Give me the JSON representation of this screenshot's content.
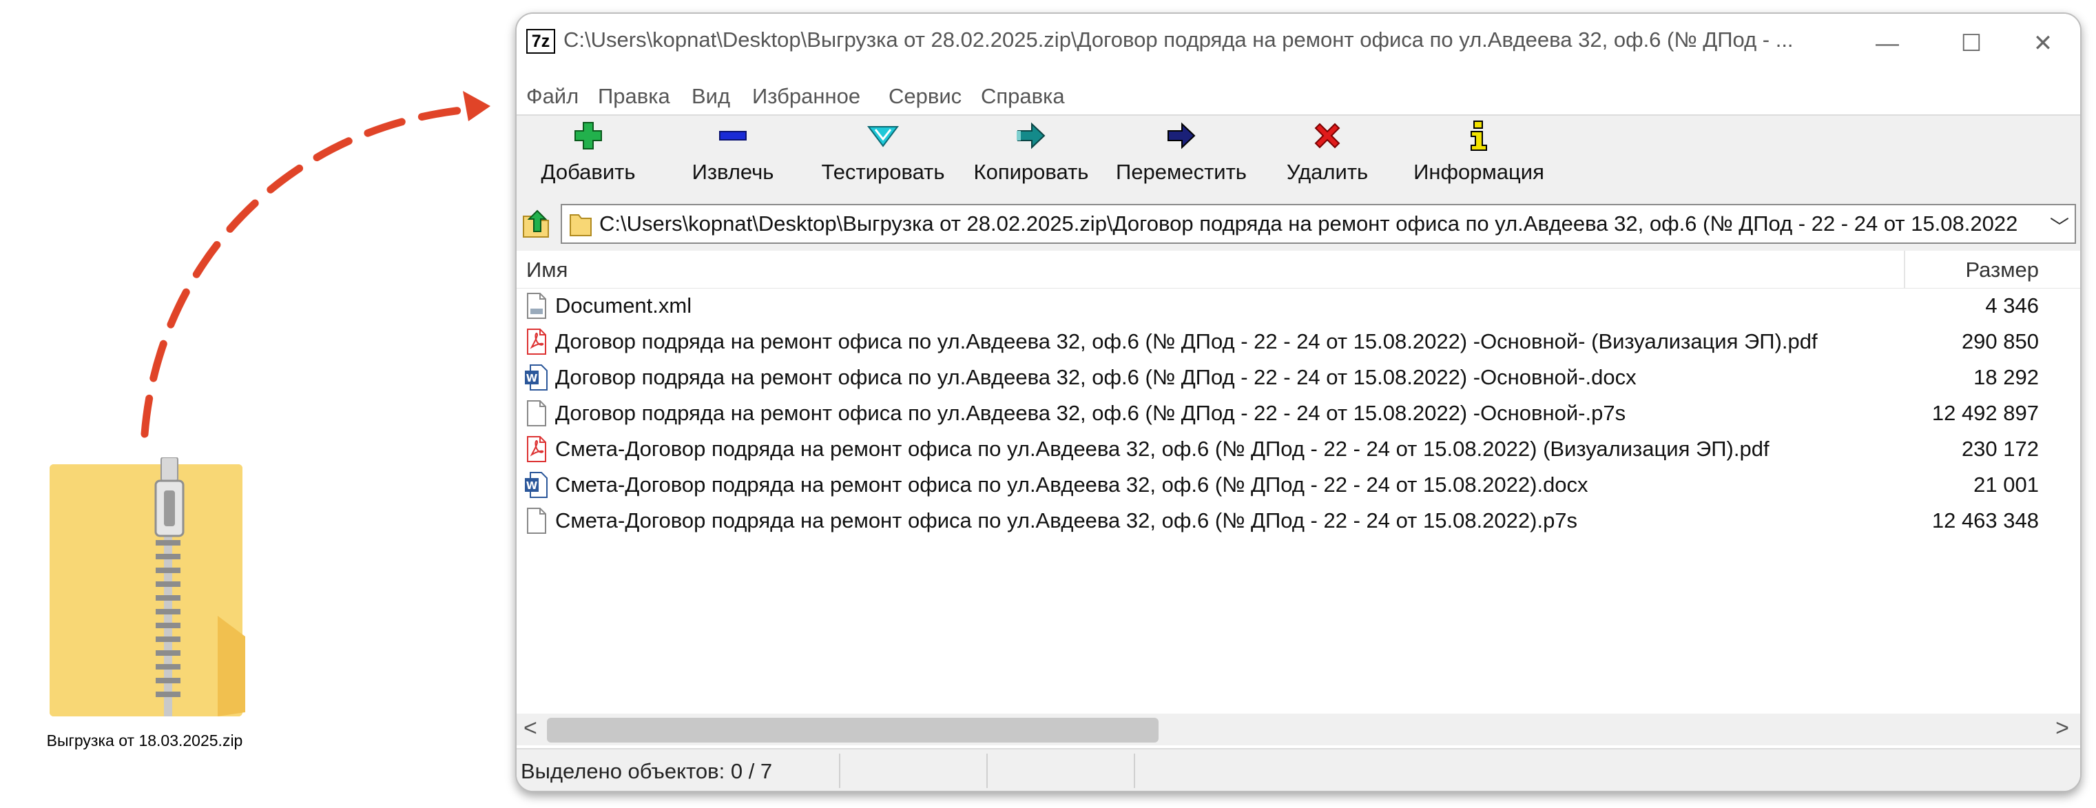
{
  "desktop": {
    "zip_label": "Выгрузка от 18.03.2025.zip"
  },
  "window": {
    "app_icon_text": "7z",
    "title": "C:\\Users\\kopnat\\Desktop\\Выгрузка от 28.02.2025.zip\\Договор подряда на ремонт офиса по ул.Авдеева 32, оф.6 (№ ДПод - ...",
    "controls": {
      "minimize": "—",
      "maximize": "☐",
      "close": "✕"
    }
  },
  "menu": [
    "Файл",
    "Правка",
    "Вид",
    "Избранное",
    "Сервис",
    "Справка"
  ],
  "toolbar": [
    {
      "label": "Добавить",
      "icon": "add-icon",
      "color": "#22b14c"
    },
    {
      "label": "Извлечь",
      "icon": "extract-icon",
      "color": "#1a2bd6"
    },
    {
      "label": "Тестировать",
      "icon": "test-icon",
      "color": "#1ec8d8"
    },
    {
      "label": "Копировать",
      "icon": "copy-icon",
      "color": "#148a8a"
    },
    {
      "label": "Переместить",
      "icon": "move-icon",
      "color": "#1a2078"
    },
    {
      "label": "Удалить",
      "icon": "delete-icon",
      "color": "#e01b1b"
    },
    {
      "label": "Информация",
      "icon": "info-icon",
      "color": "#d6c400"
    }
  ],
  "address": "C:\\Users\\kopnat\\Desktop\\Выгрузка от 28.02.2025.zip\\Договор подряда на ремонт офиса по ул.Авдеева 32, оф.6 (№ ДПод - 22 - 24 от 15.08.2022",
  "columns": {
    "name": "Имя",
    "size": "Размер"
  },
  "files": [
    {
      "name": "Document.xml",
      "size": "4 346",
      "type": "xml"
    },
    {
      "name": "Договор подряда на ремонт офиса по ул.Авдеева 32, оф.6 (№ ДПод - 22 - 24 от 15.08.2022) -Основной- (Визуализация ЭП).pdf",
      "size": "290 850",
      "type": "pdf"
    },
    {
      "name": "Договор подряда на ремонт офиса по ул.Авдеева 32, оф.6 (№ ДПод - 22 - 24 от 15.08.2022) -Основной-.docx",
      "size": "18 292",
      "type": "docx"
    },
    {
      "name": "Договор подряда на ремонт офиса по ул.Авдеева 32, оф.6 (№ ДПод - 22 - 24 от 15.08.2022) -Основной-.p7s",
      "size": "12 492 897",
      "type": "p7s"
    },
    {
      "name": "Смета-Договор подряда на ремонт офиса по ул.Авдеева 32, оф.6 (№ ДПод - 22 - 24 от 15.08.2022) (Визуализация ЭП).pdf",
      "size": "230 172",
      "type": "pdf"
    },
    {
      "name": "Смета-Договор подряда на ремонт офиса по ул.Авдеева 32, оф.6 (№ ДПод - 22 - 24 от 15.08.2022).docx",
      "size": "21 001",
      "type": "docx"
    },
    {
      "name": "Смета-Договор подряда на ремонт офиса по ул.Авдеева 32, оф.6 (№ ДПод - 22 - 24 от 15.08.2022).p7s",
      "size": "12 463 348",
      "type": "p7s"
    }
  ],
  "scroll": {
    "left": "<",
    "right": ">"
  },
  "status": "Выделено объектов: 0 / 7",
  "colors": {
    "arrow": "#e04428",
    "folder": "#f8d775",
    "accent_gray": "#f0f0f0"
  }
}
